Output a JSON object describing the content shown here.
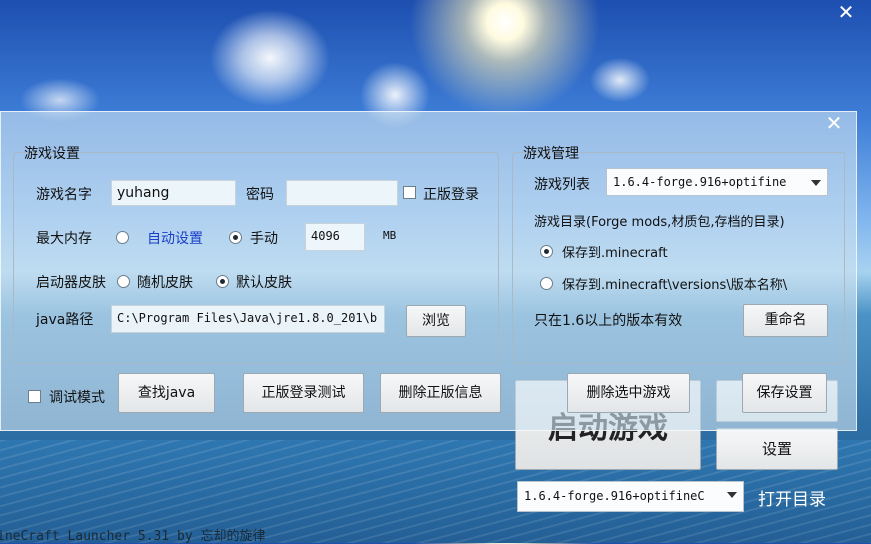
{
  "window": {
    "close_outer": "✕",
    "close_inner": "✕"
  },
  "game_settings": {
    "title": "游戏设置",
    "name_label": "游戏名字",
    "name_value": "yuhang",
    "password_label": "密码",
    "password_value": "",
    "genuine_login_label": "正版登录",
    "genuine_login_checked": false,
    "memory_label": "最大内存",
    "auto_set_label": "自动设置",
    "manual_label": "手动",
    "memory_mode": "manual",
    "memory_value": "4096",
    "memory_unit": "MB",
    "skin_label": "启动器皮肤",
    "random_skin_label": "随机皮肤",
    "default_skin_label": "默认皮肤",
    "skin_mode": "default",
    "java_path_label": "java路径",
    "java_path_value": "C:\\Program Files\\Java\\jre1.8.0_201\\b",
    "browse_label": "浏览"
  },
  "game_management": {
    "title": "游戏管理",
    "list_label": "游戏列表",
    "list_selected": "1.6.4-forge.916+optifine",
    "dir_label": "游戏目录(Forge mods,材质包,存档的目录)",
    "save_to_minecraft": "保存到.minecraft",
    "save_to_versions": "保存到.minecraft\\versions\\版本名称\\",
    "dir_mode": "minecraft",
    "note": "只在1.6以上的版本有效",
    "rename_label": "重命名"
  },
  "bottom_bar": {
    "debug_label": "调试模式",
    "debug_checked": false,
    "find_java": "查找java",
    "test_login": "正版登录测试",
    "delete_genuine": "删除正版信息",
    "delete_selected": "删除选中游戏",
    "save_settings": "保存设置"
  },
  "launcher": {
    "launch_label": "启动游戏",
    "settings_label": "设置",
    "version_selected": "1.6.4-forge.916+optifineC",
    "open_dir_label": "打开目录",
    "footer": "ineCraft Launcher 5.31 by 忘却的旋律"
  }
}
